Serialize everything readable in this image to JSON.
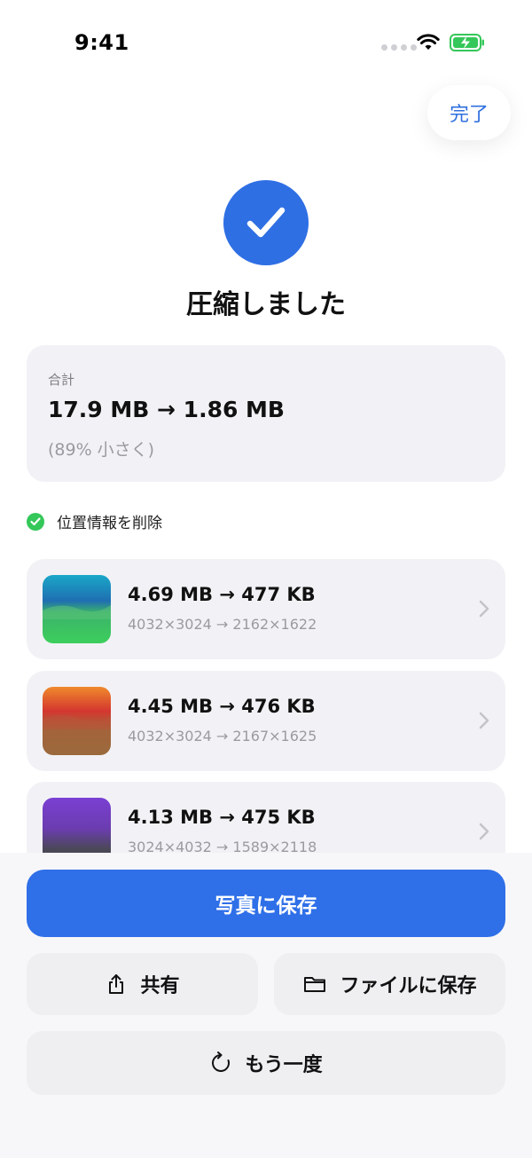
{
  "status_bar": {
    "time": "9:41"
  },
  "header": {
    "done_label": "完了"
  },
  "result": {
    "title": "圧縮しました"
  },
  "summary": {
    "label": "合計",
    "size_change": "17.9 MB → 1.86 MB",
    "reduction": "(89% 小さく)"
  },
  "options": {
    "location_removed_label": "位置情報を削除"
  },
  "items": [
    {
      "size_change": "4.69 MB → 477 KB",
      "dimension_change": "4032×3024 → 2162×1622"
    },
    {
      "size_change": "4.45 MB → 476 KB",
      "dimension_change": "4032×3024 → 2167×1625"
    },
    {
      "size_change": "4.13 MB → 475 KB",
      "dimension_change": "3024×4032 → 1589×2118"
    }
  ],
  "actions": {
    "save_photos_label": "写真に保存",
    "share_label": "共有",
    "save_files_label": "ファイルに保存",
    "retry_label": "もう一度"
  },
  "colors": {
    "accent": "#2f6fe8",
    "success_green": "#34c759",
    "card_bg": "#f2f2f6"
  },
  "icons": [
    "wifi-icon",
    "battery-charging-icon",
    "checkmark-icon",
    "chevron-right-icon",
    "share-icon",
    "folder-icon",
    "refresh-icon"
  ]
}
